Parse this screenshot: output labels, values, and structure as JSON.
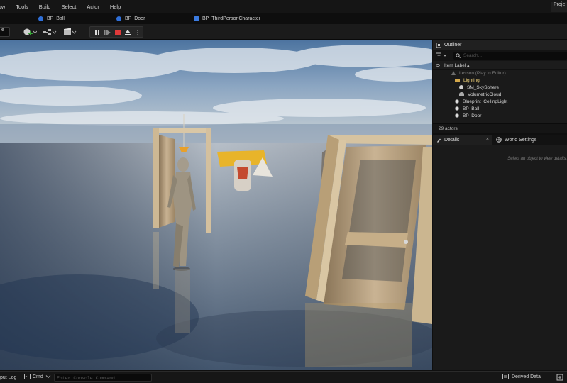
{
  "menu": {
    "items": [
      "low",
      "Tools",
      "Build",
      "Select",
      "Actor",
      "Help"
    ],
    "project_label": "Proje"
  },
  "tabs": [
    {
      "label": "BP_Ball",
      "icon": "blueprint-icon"
    },
    {
      "label": "BP_Door",
      "icon": "blueprint-icon"
    },
    {
      "label": "BP_ThirdPersonCharacter",
      "icon": "character-blueprint-icon"
    }
  ],
  "toolbar": {
    "mode_label": "e",
    "play_controls": [
      "pause-icon",
      "skip-frame-icon",
      "stop-icon",
      "eject-icon",
      "more-icon"
    ]
  },
  "outliner": {
    "tab_label": "Outliner",
    "search_placeholder": "Search...",
    "column_header": "Item Label ▴",
    "rows": [
      {
        "label": "Lesson (Play In Editor)",
        "icon": "level-icon"
      },
      {
        "label": "Lighting",
        "icon": "folder-icon"
      },
      {
        "label": "SM_SkySphere",
        "icon": "sphere-icon"
      },
      {
        "label": "VolumetricCloud",
        "icon": "cloud-icon"
      },
      {
        "label": "Blueprint_CeilingLight",
        "icon": "blueprint-actor-icon"
      },
      {
        "label": "BP_Ball",
        "icon": "blueprint-actor-icon"
      },
      {
        "label": "BP_Door",
        "icon": "blueprint-actor-icon"
      }
    ],
    "actors_count": "29 actors"
  },
  "details": {
    "tab_label": "Details",
    "close_label": "×",
    "world_settings_label": "World Settings",
    "hint": "Select an object to view details."
  },
  "statusbar": {
    "output_log": "put Log",
    "cmd_label": "Cmd",
    "cmd_placeholder": "Enter Console Command",
    "derived_data": "Derived Data"
  },
  "colors": {
    "accent_blue": "#2f6fd8",
    "stop_red": "#e03a3a",
    "folder_gold": "#d3a74a"
  }
}
